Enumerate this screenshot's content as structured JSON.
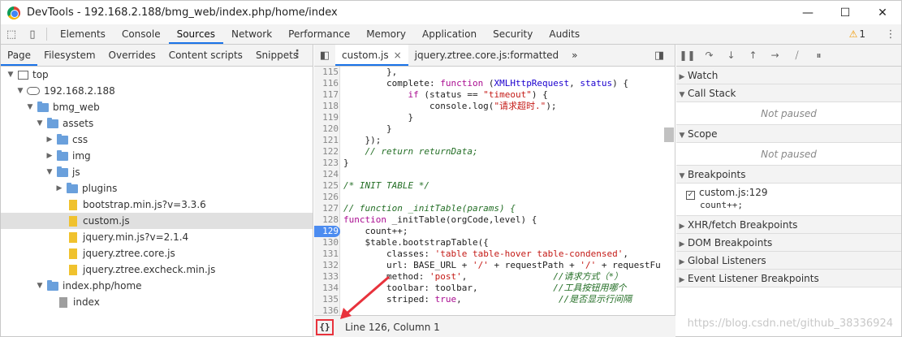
{
  "window": {
    "title": "DevTools - 192.168.2.188/bmg_web/index.php/home/index",
    "minimize": "—",
    "maximize": "☐",
    "close": "✕"
  },
  "main_tabs": [
    "Elements",
    "Console",
    "Sources",
    "Network",
    "Performance",
    "Memory",
    "Application",
    "Security",
    "Audits"
  ],
  "active_main_tab": "Sources",
  "warnings": {
    "icon": "warning-icon",
    "count": "1"
  },
  "left": {
    "subtabs": [
      "Page",
      "Filesystem",
      "Overrides",
      "Content scripts",
      "Snippets"
    ],
    "tree": [
      {
        "label": "top",
        "depth": 0,
        "kind": "frame",
        "arrow": "▼"
      },
      {
        "label": "192.168.2.188",
        "depth": 1,
        "kind": "cloud",
        "arrow": "▼"
      },
      {
        "label": "bmg_web",
        "depth": 2,
        "kind": "folder",
        "arrow": "▼"
      },
      {
        "label": "assets",
        "depth": 3,
        "kind": "folder",
        "arrow": "▼"
      },
      {
        "label": "css",
        "depth": 4,
        "kind": "folder",
        "arrow": "▶"
      },
      {
        "label": "img",
        "depth": 4,
        "kind": "folder",
        "arrow": "▶"
      },
      {
        "label": "js",
        "depth": 4,
        "kind": "folder",
        "arrow": "▼"
      },
      {
        "label": "plugins",
        "depth": 5,
        "kind": "folder",
        "arrow": "▶"
      },
      {
        "label": "bootstrap.min.js?v=3.3.6",
        "depth": 5,
        "kind": "file",
        "arrow": ""
      },
      {
        "label": "custom.js",
        "depth": 5,
        "kind": "file",
        "arrow": "",
        "selected": true
      },
      {
        "label": "jquery.min.js?v=2.1.4",
        "depth": 5,
        "kind": "file",
        "arrow": ""
      },
      {
        "label": "jquery.ztree.core.js",
        "depth": 5,
        "kind": "file",
        "arrow": ""
      },
      {
        "label": "jquery.ztree.excheck.min.js",
        "depth": 5,
        "kind": "file",
        "arrow": ""
      },
      {
        "label": "index.php/home",
        "depth": 3,
        "kind": "folder",
        "arrow": "▼"
      },
      {
        "label": "index",
        "depth": 4,
        "kind": "greyfile",
        "arrow": ""
      }
    ]
  },
  "editor": {
    "tabs": [
      {
        "label": "custom.js",
        "close": "×"
      },
      {
        "label": "jquery.ztree.core.js:formatted"
      }
    ],
    "more": "»",
    "breakpoint_line": "129",
    "lines": [
      {
        "n": "115",
        "html": "        },"
      },
      {
        "n": "116",
        "html": "        complete: <span class='kw'>function</span> (<span class='id'>XMLHttpRequest</span>, <span class='id'>status</span>) {"
      },
      {
        "n": "117",
        "html": "            <span class='kw'>if</span> (status == <span class='str'>\"timeout\"</span>) {"
      },
      {
        "n": "118",
        "html": "                console.log(<span class='str'>\"请求超时.\"</span>);"
      },
      {
        "n": "119",
        "html": "            }"
      },
      {
        "n": "120",
        "html": "        }"
      },
      {
        "n": "121",
        "html": "    });"
      },
      {
        "n": "122",
        "html": "    <span class='cm'>// return returnData;</span>"
      },
      {
        "n": "123",
        "html": "}"
      },
      {
        "n": "124",
        "html": ""
      },
      {
        "n": "125",
        "html": "<span class='cm'>/* INIT TABLE */</span>"
      },
      {
        "n": "126",
        "html": ""
      },
      {
        "n": "127",
        "html": "<span class='cm'>// function _initTable(params) {</span>"
      },
      {
        "n": "128",
        "html": "<span class='kw'>function</span> _initTable(orgCode,level) {"
      },
      {
        "n": "129",
        "html": "    count++;"
      },
      {
        "n": "130",
        "html": "    $table.bootstrapTable({"
      },
      {
        "n": "131",
        "html": "        classes: <span class='str'>'table table-hover table-condensed'</span>,"
      },
      {
        "n": "132",
        "html": "        url: BASE_URL + <span class='str'>'/'</span> + requestPath + <span class='str'>'/'</span> + requestFu"
      },
      {
        "n": "133",
        "html": "        method: <span class='str'>'post'</span>,                <span class='cm'>//请求方式（*）</span>"
      },
      {
        "n": "134",
        "html": "        toolbar: toolbar,              <span class='cm'>//工具按钮用哪个</span>"
      },
      {
        "n": "135",
        "html": "        striped: <span class='kw'>true</span>,                  <span class='cm'>//是否显示行间隔</span>"
      },
      {
        "n": "136",
        "html": ""
      }
    ],
    "status": "Line 126, Column 1",
    "pretty_print": "{}"
  },
  "right": {
    "sections": {
      "watch": "Watch",
      "call_stack": "Call Stack",
      "scope": "Scope",
      "breakpoints": "Breakpoints",
      "xhr": "XHR/fetch Breakpoints",
      "dom": "DOM Breakpoints",
      "global": "Global Listeners",
      "event": "Event Listener Breakpoints"
    },
    "not_paused": "Not paused",
    "breakpoint_item": {
      "file": "custom.js:129",
      "code": "count++;"
    }
  },
  "watermark": "https://blog.csdn.net/github_38336924",
  "colors": {
    "accent": "#1a73e8",
    "annotation": "#e8323c",
    "breakpoint": "#4c8cf0"
  }
}
